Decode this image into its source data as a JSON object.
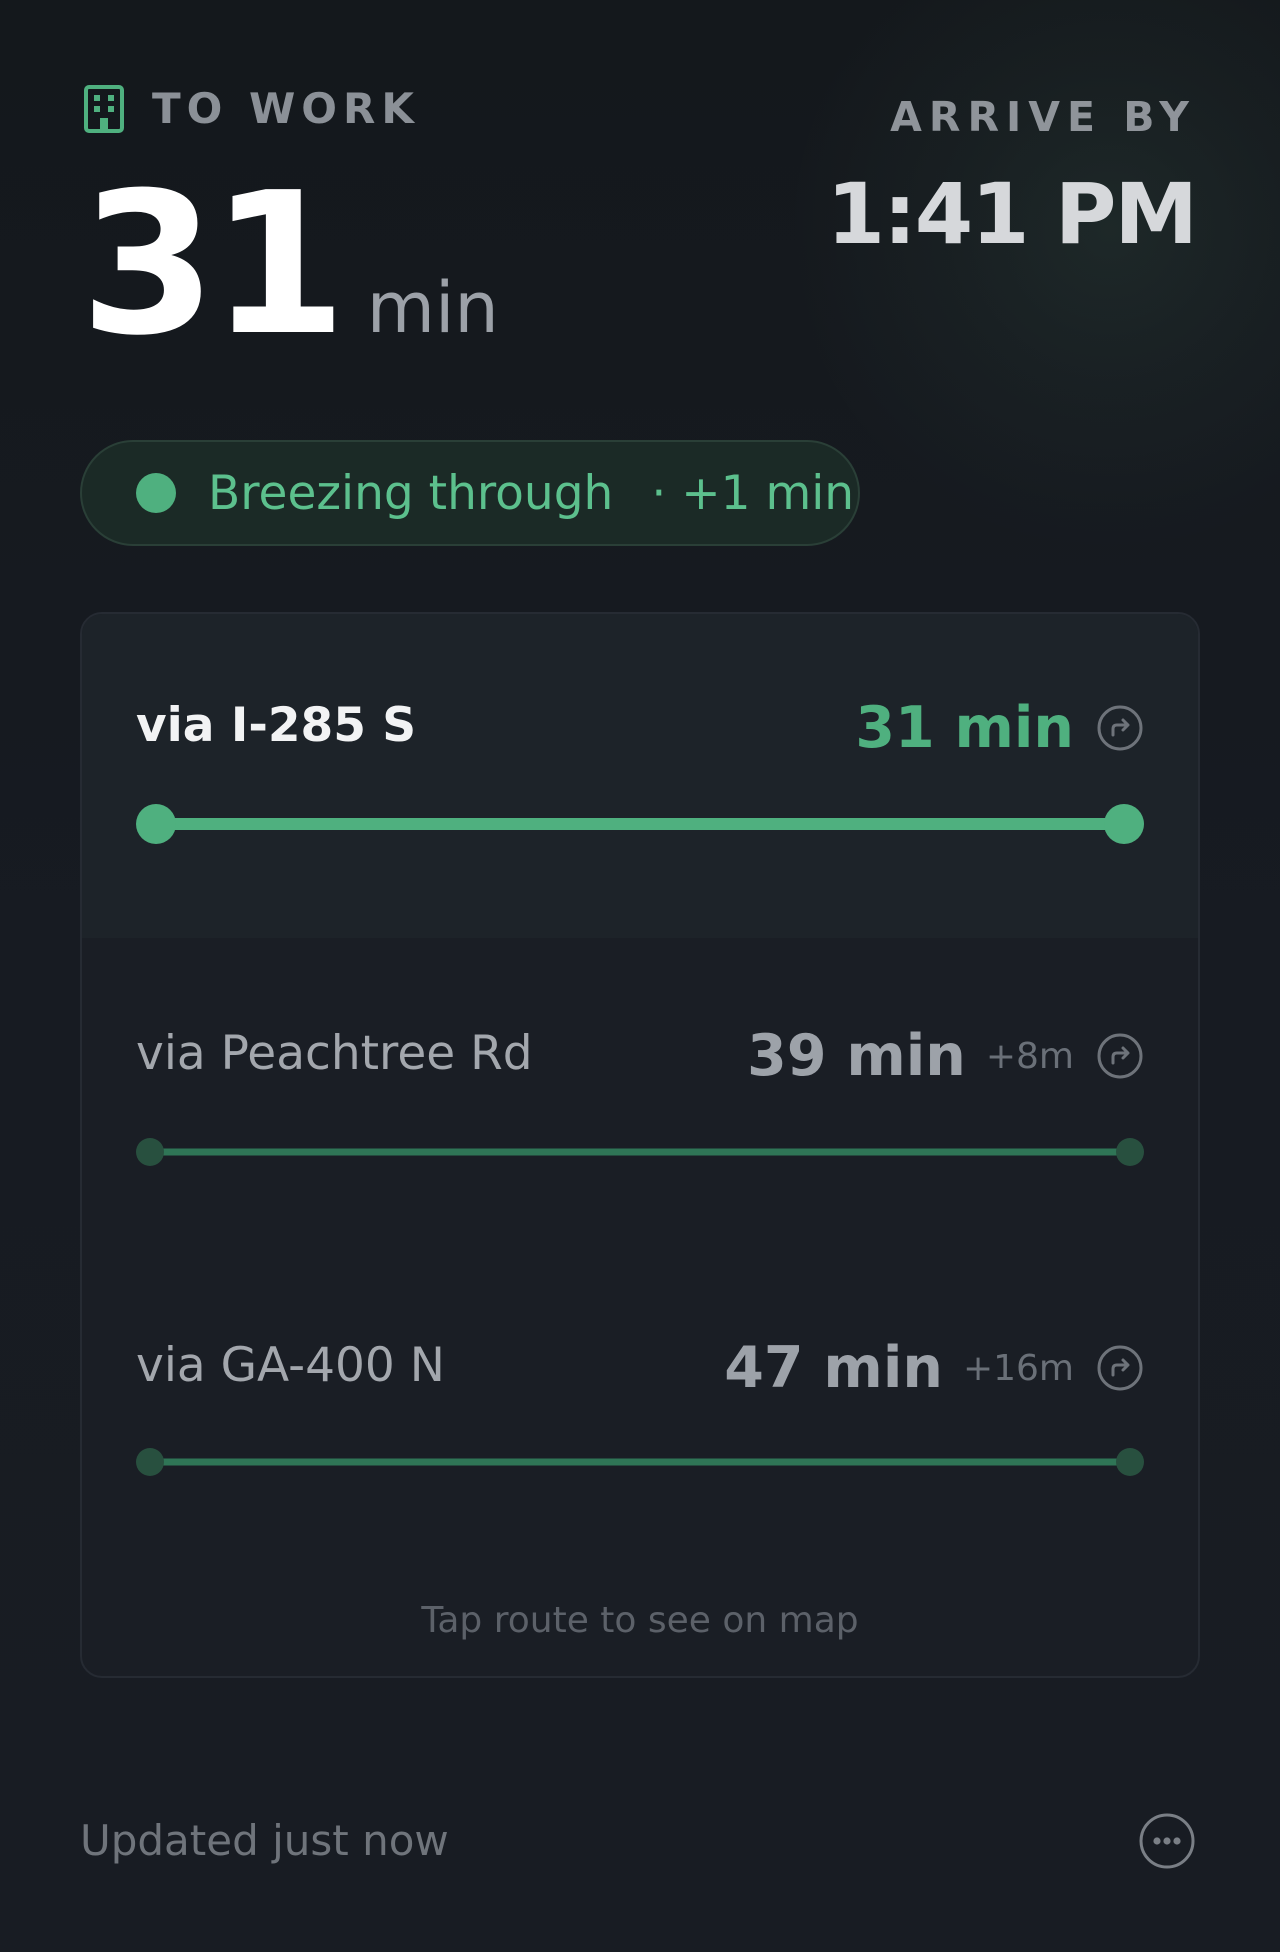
{
  "header": {
    "destination_label": "TO WORK",
    "destination_icon": "building-icon",
    "duration_value": "31",
    "duration_unit": "min",
    "arrive_label": "ARRIVE BY",
    "arrive_time": "1:41 PM"
  },
  "status": {
    "text": "Breezing through",
    "delta": "· +1 min",
    "color": "#4fb07f"
  },
  "routes": [
    {
      "name": "via I-285 S",
      "time": "31 min",
      "delta": "",
      "selected": true,
      "icon": "route-arrow-icon"
    },
    {
      "name": "via Peachtree Rd",
      "time": "39 min",
      "delta": "+8m",
      "selected": false,
      "icon": "route-arrow-icon"
    },
    {
      "name": "via GA-400 N",
      "time": "47 min",
      "delta": "+16m",
      "selected": false,
      "icon": "route-arrow-icon"
    }
  ],
  "hint": "Tap route to see on map",
  "footer": {
    "updated_text": "Updated just now",
    "more_icon": "more-icon"
  },
  "colors": {
    "accent": "#4fb07f",
    "accent_dim": "#2f7556",
    "background": "#161a20",
    "card": "#1a1e25"
  }
}
